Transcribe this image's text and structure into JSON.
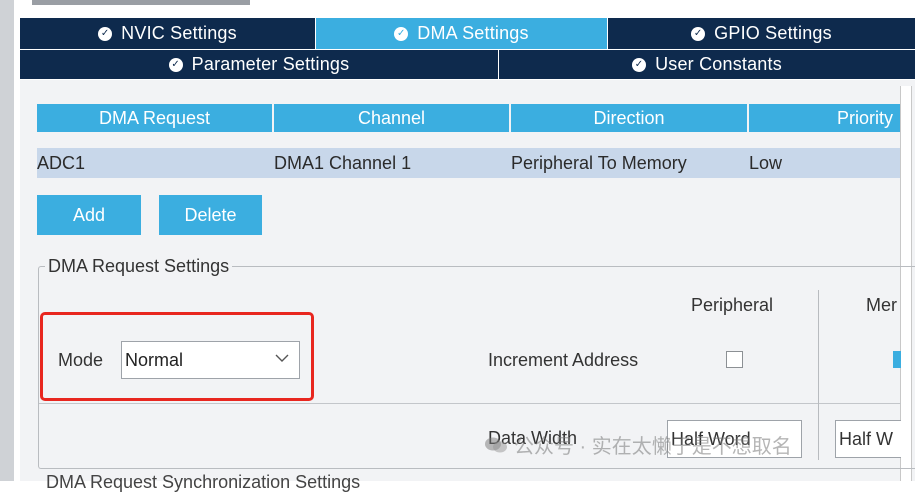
{
  "tabs_row1": [
    {
      "label": "NVIC Settings",
      "active": false
    },
    {
      "label": "DMA Settings",
      "active": true
    },
    {
      "label": "GPIO Settings",
      "active": false
    }
  ],
  "tabs_row2": [
    {
      "label": "Parameter Settings"
    },
    {
      "label": "User Constants"
    }
  ],
  "table": {
    "headers": [
      "DMA Request",
      "Channel",
      "Direction",
      "Priority"
    ],
    "rows": [
      [
        "ADC1",
        "DMA1 Channel 1",
        "Peripheral To Memory",
        "Low"
      ]
    ]
  },
  "buttons": {
    "add": "Add",
    "delete": "Delete"
  },
  "settings": {
    "legend": "DMA Request Settings",
    "mode_label": "Mode",
    "mode_value": "Normal",
    "col_peripheral": "Peripheral",
    "col_memory_cut": "Mer",
    "increment_label": "Increment Address",
    "increment_peripheral_checked": false,
    "increment_memory_checked": true,
    "data_width_label": "Data Width",
    "data_width_peripheral": "Half Word",
    "data_width_memory_cut": "Half W"
  },
  "watermark": "公众号 · 实在太懒于是不想取名",
  "bottom_cut_text": "DMA Request Synchronization Settings",
  "colors": {
    "navy": "#0e2a4d",
    "accent": "#3baee0",
    "highlight": "#e8261f"
  }
}
